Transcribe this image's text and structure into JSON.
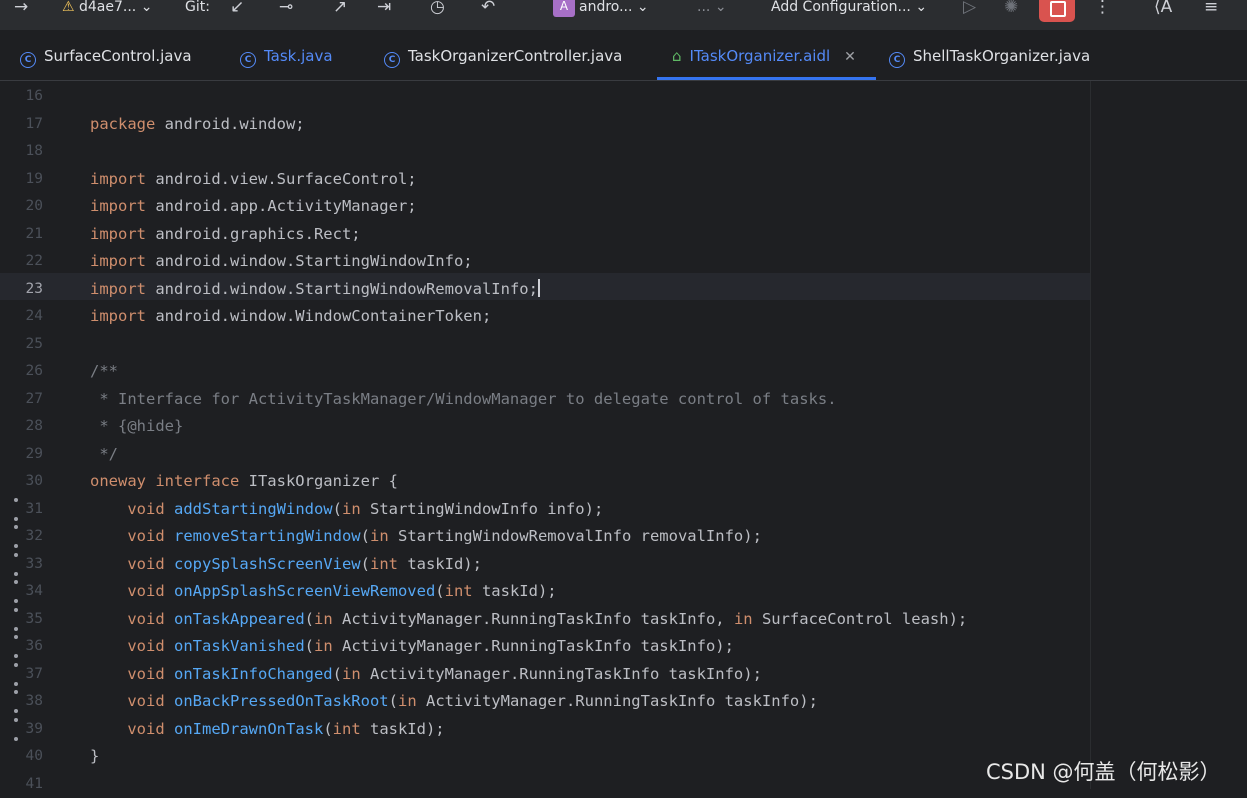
{
  "toolbar": {
    "branch": "d4ae7...",
    "git_label": "Git:",
    "project": "andro...",
    "project_badge": "A",
    "more": "...",
    "config": "Add Configuration..."
  },
  "tabs": [
    {
      "label": "SurfaceControl.java"
    },
    {
      "label": "Task.java"
    },
    {
      "label": "TaskOrganizerController.java"
    },
    {
      "label": "ITaskOrganizer.aidl"
    },
    {
      "label": "ShellTaskOrganizer.java"
    }
  ],
  "editor": {
    "lines": [
      {
        "n": "16",
        "t": []
      },
      {
        "n": "17",
        "t": [
          [
            "kw",
            "package"
          ],
          [
            "tx",
            " android.window;"
          ]
        ]
      },
      {
        "n": "18",
        "t": []
      },
      {
        "n": "19",
        "t": [
          [
            "kw",
            "import"
          ],
          [
            "tx",
            " android.view.SurfaceControl;"
          ]
        ]
      },
      {
        "n": "20",
        "t": [
          [
            "kw",
            "import"
          ],
          [
            "tx",
            " android.app.ActivityManager;"
          ]
        ]
      },
      {
        "n": "21",
        "t": [
          [
            "kw",
            "import"
          ],
          [
            "tx",
            " android.graphics.Rect;"
          ]
        ]
      },
      {
        "n": "22",
        "t": [
          [
            "kw",
            "import"
          ],
          [
            "tx",
            " android.window.StartingWindowInfo;"
          ]
        ]
      },
      {
        "n": "23",
        "t": [
          [
            "kw",
            "import"
          ],
          [
            "tx",
            " android.window.StartingWindowRemovalInfo;"
          ]
        ],
        "cur": true
      },
      {
        "n": "24",
        "t": [
          [
            "kw",
            "import"
          ],
          [
            "tx",
            " android.window.WindowContainerToken;"
          ]
        ]
      },
      {
        "n": "25",
        "t": []
      },
      {
        "n": "26",
        "t": [
          [
            "cm",
            "/**"
          ]
        ]
      },
      {
        "n": "27",
        "t": [
          [
            "cm",
            " * Interface for ActivityTaskManager/WindowManager to delegate control of tasks."
          ]
        ]
      },
      {
        "n": "28",
        "t": [
          [
            "cm",
            " * {@hide}"
          ]
        ]
      },
      {
        "n": "29",
        "t": [
          [
            "cm",
            " */"
          ]
        ]
      },
      {
        "n": "30",
        "t": [
          [
            "kw",
            "oneway interface"
          ],
          [
            "tx",
            " ITaskOrganizer {"
          ]
        ]
      },
      {
        "n": "31",
        "t": [
          [
            "tx",
            "    "
          ],
          [
            "kw",
            "void "
          ],
          [
            "fn",
            "addStartingWindow"
          ],
          [
            "tx",
            "("
          ],
          [
            "kw",
            "in "
          ],
          [
            "tx",
            "StartingWindowInfo info);"
          ]
        ],
        "dot": true
      },
      {
        "n": "32",
        "t": [
          [
            "tx",
            "    "
          ],
          [
            "kw",
            "void "
          ],
          [
            "fn",
            "removeStartingWindow"
          ],
          [
            "tx",
            "("
          ],
          [
            "kw",
            "in "
          ],
          [
            "tx",
            "StartingWindowRemovalInfo removalInfo);"
          ]
        ],
        "dot": true
      },
      {
        "n": "33",
        "t": [
          [
            "tx",
            "    "
          ],
          [
            "kw",
            "void "
          ],
          [
            "fn",
            "copySplashScreenView"
          ],
          [
            "tx",
            "("
          ],
          [
            "kw",
            "int "
          ],
          [
            "tx",
            "taskId);"
          ]
        ],
        "dot": true
      },
      {
        "n": "34",
        "t": [
          [
            "tx",
            "    "
          ],
          [
            "kw",
            "void "
          ],
          [
            "fn",
            "onAppSplashScreenViewRemoved"
          ],
          [
            "tx",
            "("
          ],
          [
            "kw",
            "int "
          ],
          [
            "tx",
            "taskId);"
          ]
        ],
        "dot": true
      },
      {
        "n": "35",
        "t": [
          [
            "tx",
            "    "
          ],
          [
            "kw",
            "void "
          ],
          [
            "fn",
            "onTaskAppeared"
          ],
          [
            "tx",
            "("
          ],
          [
            "kw",
            "in "
          ],
          [
            "tx",
            "ActivityManager.RunningTaskInfo taskInfo, "
          ],
          [
            "kw",
            "in "
          ],
          [
            "tx",
            "SurfaceControl leash);"
          ]
        ],
        "dot": true
      },
      {
        "n": "36",
        "t": [
          [
            "tx",
            "    "
          ],
          [
            "kw",
            "void "
          ],
          [
            "fn",
            "onTaskVanished"
          ],
          [
            "tx",
            "("
          ],
          [
            "kw",
            "in "
          ],
          [
            "tx",
            "ActivityManager.RunningTaskInfo taskInfo);"
          ]
        ],
        "dot": true
      },
      {
        "n": "37",
        "t": [
          [
            "tx",
            "    "
          ],
          [
            "kw",
            "void "
          ],
          [
            "fn",
            "onTaskInfoChanged"
          ],
          [
            "tx",
            "("
          ],
          [
            "kw",
            "in "
          ],
          [
            "tx",
            "ActivityManager.RunningTaskInfo taskInfo);"
          ]
        ],
        "dot": true
      },
      {
        "n": "38",
        "t": [
          [
            "tx",
            "    "
          ],
          [
            "kw",
            "void "
          ],
          [
            "fn",
            "onBackPressedOnTaskRoot"
          ],
          [
            "tx",
            "("
          ],
          [
            "kw",
            "in "
          ],
          [
            "tx",
            "ActivityManager.RunningTaskInfo taskInfo);"
          ]
        ],
        "dot": true
      },
      {
        "n": "39",
        "t": [
          [
            "tx",
            "    "
          ],
          [
            "kw",
            "void "
          ],
          [
            "fn",
            "onImeDrawnOnTask"
          ],
          [
            "tx",
            "("
          ],
          [
            "kw",
            "int "
          ],
          [
            "tx",
            "taskId);"
          ]
        ],
        "dot": true
      },
      {
        "n": "40",
        "t": [
          [
            "tx",
            "}"
          ]
        ]
      },
      {
        "n": "41",
        "t": []
      }
    ]
  },
  "watermark": "CSDN @何盖（何松影）"
}
